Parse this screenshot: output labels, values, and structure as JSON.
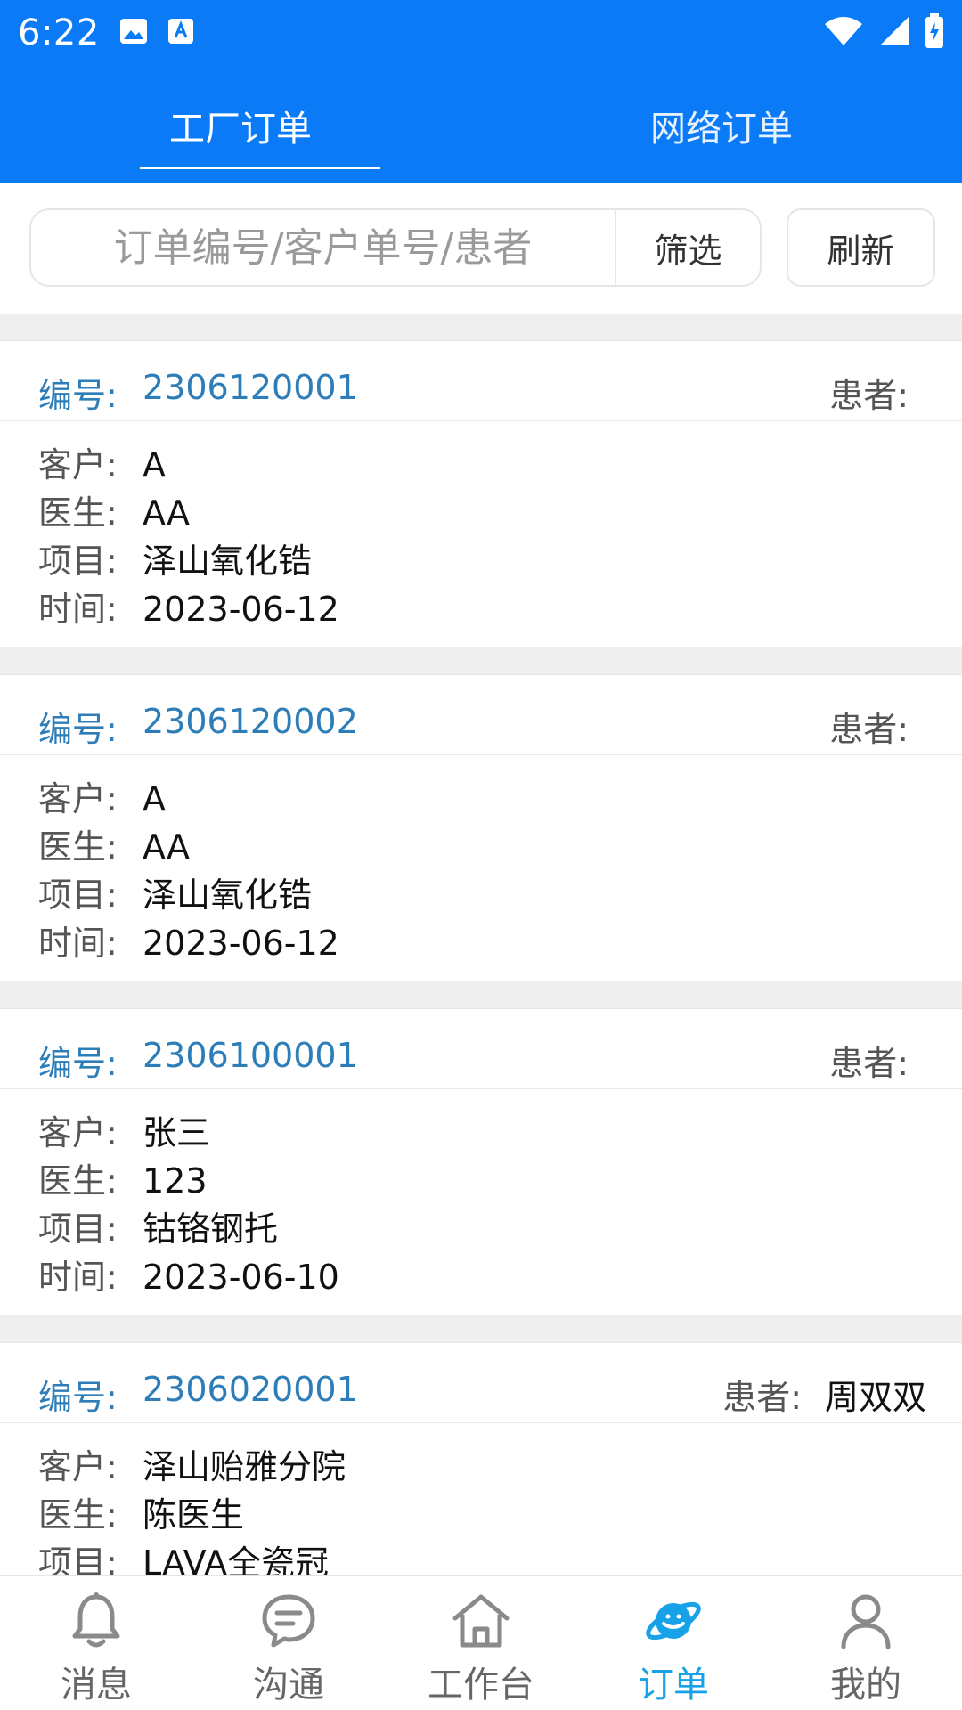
{
  "status_bar": {
    "time": "6:22"
  },
  "tabs": [
    {
      "label": "工厂订单",
      "active": true
    },
    {
      "label": "网络订单",
      "active": false
    }
  ],
  "search": {
    "placeholder": "订单编号/客户单号/患者",
    "filter_label": "筛选",
    "refresh_label": "刷新"
  },
  "field_labels": {
    "id": "编号:",
    "patient": "患者:",
    "customer": "客户:",
    "doctor": "医生:",
    "project": "项目:",
    "time": "时间:"
  },
  "orders": [
    {
      "id": "2306120001",
      "patient": "",
      "customer": "A",
      "doctor": "AA",
      "project": "泽山氧化锆",
      "time": "2023-06-12"
    },
    {
      "id": "2306120002",
      "patient": "",
      "customer": "A",
      "doctor": "AA",
      "project": "泽山氧化锆",
      "time": "2023-06-12"
    },
    {
      "id": "2306100001",
      "patient": "",
      "customer": "张三",
      "doctor": "123",
      "project": "钴铬钢托",
      "time": "2023-06-10"
    },
    {
      "id": "2306020001",
      "patient": "周双双",
      "customer": "泽山贻雅分院",
      "doctor": "陈医生",
      "project": "LAVA全瓷冠",
      "time": ""
    }
  ],
  "bottom_nav": [
    {
      "label": "消息",
      "icon": "bell-icon",
      "active": false
    },
    {
      "label": "沟通",
      "icon": "chat-icon",
      "active": false
    },
    {
      "label": "工作台",
      "icon": "home-icon",
      "active": false
    },
    {
      "label": "订单",
      "icon": "planet-icon",
      "active": true
    },
    {
      "label": "我的",
      "icon": "user-icon",
      "active": false
    }
  ],
  "colors": {
    "primary": "#0A7AF7",
    "accent": "#17A2E8",
    "id_text": "#2D7DB8"
  }
}
